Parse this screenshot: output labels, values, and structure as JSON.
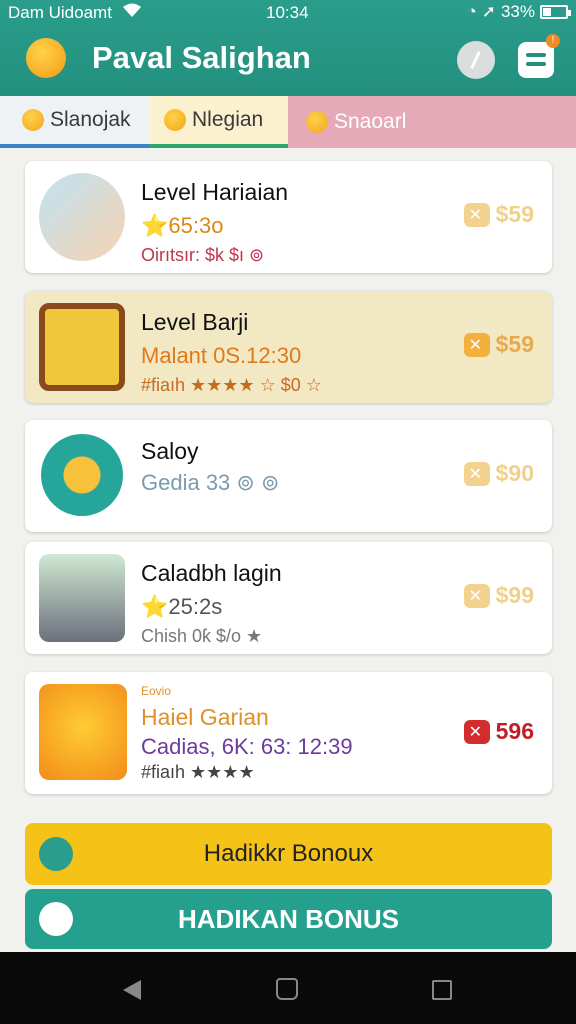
{
  "status": {
    "carrier": "Dam Uidoamt",
    "time": "10:34",
    "battery": "33%"
  },
  "header": {
    "title": "Paval Salighan"
  },
  "tabs": [
    {
      "label": "Slanojak"
    },
    {
      "label": "Nlegian"
    },
    {
      "label": "Snaoarl"
    }
  ],
  "items": [
    {
      "name": "Level Hariaian",
      "line2": "⭐65:3o",
      "line3": "Oirıtsır: $k $ı ⊚",
      "price": "$59"
    },
    {
      "name": "Level Barji",
      "line2": "Malant 0S.12:30",
      "line3": "#fiaıh ★★★★ ☆ $0 ☆",
      "price": "$59"
    },
    {
      "name": "Saloy",
      "line2": "Gedia 33 ⊚ ⊚",
      "line3": "",
      "price": "$90"
    },
    {
      "name": "Caladbh lagin",
      "line2": "⭐25:2s",
      "line3": "Chish 0ƙ $/o ★",
      "price": "$99"
    },
    {
      "small": "Eovio",
      "name": "Haiel Garian",
      "line2": "Cadias, 6K: 63: 12:39",
      "line3": "#fiaıh ★★★★",
      "price": "596"
    }
  ],
  "buttons": {
    "bonus_primary": "Hadikkr Bonoux",
    "bonus_secondary": "HADIKAN BONUS"
  },
  "colors": {
    "header": "#2a9d8c",
    "yellow": "#f5c317",
    "teal_button": "#25a08e",
    "price_red": "#c02025"
  }
}
